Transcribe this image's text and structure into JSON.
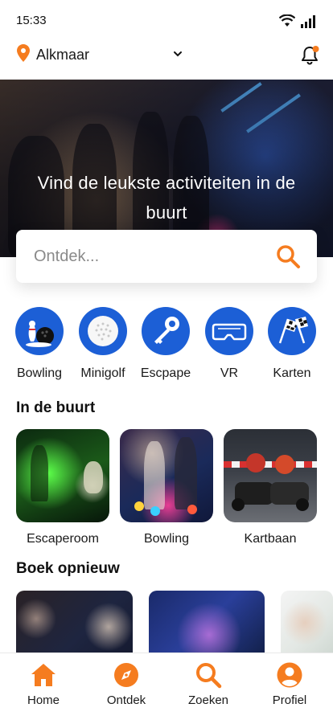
{
  "status_bar": {
    "time": "15:33",
    "wifi_icon": "wifi-icon",
    "signal_icon": "signal-icon"
  },
  "location": {
    "city": "Alkmaar",
    "pin_icon": "location-pin-icon",
    "chevron_icon": "chevron-down-icon",
    "bell_icon": "bell-icon",
    "has_notification": true
  },
  "hero": {
    "title": "Vind de leukste activiteiten in de buurt"
  },
  "search": {
    "placeholder": "Ontdek...",
    "icon": "search-icon"
  },
  "categories": [
    {
      "label": "Bowling",
      "icon": "bowling-icon"
    },
    {
      "label": "Minigolf",
      "icon": "golf-ball-icon"
    },
    {
      "label": "Escpape",
      "icon": "key-icon"
    },
    {
      "label": "VR",
      "icon": "vr-headset-icon"
    },
    {
      "label": "Karten",
      "icon": "checkered-flags-icon"
    }
  ],
  "nearby": {
    "title": "In de buurt",
    "items": [
      {
        "label": "Escaperoom"
      },
      {
        "label": "Bowling"
      },
      {
        "label": "Kartbaan"
      }
    ]
  },
  "rebook": {
    "title": "Boek opnieuw"
  },
  "bottom_nav": [
    {
      "label": "Home",
      "icon": "home-icon",
      "active": true
    },
    {
      "label": "Ontdek",
      "icon": "compass-icon",
      "active": false
    },
    {
      "label": "Zoeken",
      "icon": "search-icon",
      "active": false
    },
    {
      "label": "Profiel",
      "icon": "profile-icon",
      "active": false
    }
  ],
  "colors": {
    "accent": "#f57c1f",
    "category_blue": "#1c5fd6",
    "text": "#1a1a1a"
  }
}
